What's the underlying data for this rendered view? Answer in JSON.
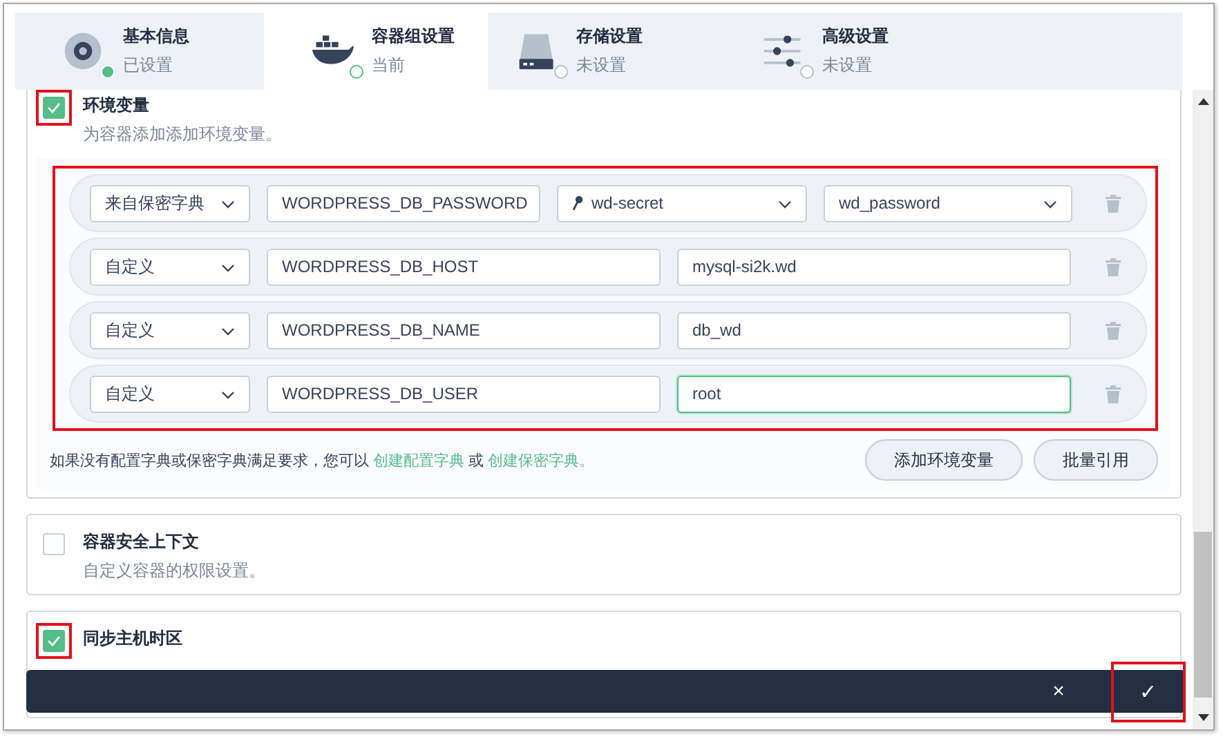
{
  "tabs": [
    {
      "title": "基本信息",
      "status_text": "已设置",
      "completed": true,
      "selected": false
    },
    {
      "title": "容器组设置",
      "status_text": "当前",
      "completed": false,
      "selected": true
    },
    {
      "title": "存储设置",
      "status_text": "未设置",
      "completed": false,
      "selected": false
    },
    {
      "title": "高级设置",
      "status_text": "未设置",
      "completed": false,
      "selected": false
    }
  ],
  "sections": [
    {
      "kind": "env",
      "title": "环境变量",
      "description": "为容器添加添加环境变量。",
      "checked": true,
      "highlighted": true,
      "rows_highlighted": true,
      "rows": [
        {
          "kind": "secret",
          "type": "来自保密字典",
          "name": "WORDPRESS_DB_PASSWORD",
          "secret": "wd-secret",
          "key": "wd_password",
          "focused": false
        },
        {
          "kind": "custom",
          "type": "自定义",
          "name": "WORDPRESS_DB_HOST",
          "value": "mysql-si2k.wd",
          "focused": false
        },
        {
          "kind": "custom",
          "type": "自定义",
          "name": "WORDPRESS_DB_NAME",
          "value": "db_wd",
          "focused": false
        },
        {
          "kind": "custom",
          "type": "自定义",
          "name": "WORDPRESS_DB_USER",
          "value": "root",
          "focused": true
        }
      ],
      "hint": {
        "text": "如果没有配置字典或保密字典满足要求，您可以",
        "links": [
          "创建配置字典",
          "创建保密字典。"
        ],
        "separator": "或"
      },
      "buttons": [
        "添加环境变量",
        "批量引用"
      ]
    },
    {
      "kind": "plain",
      "title": "容器安全上下文",
      "description": "自定义容器的权限设置。",
      "checked": false,
      "highlighted": false
    },
    {
      "kind": "plain",
      "title": "同步主机时区",
      "checked": true,
      "highlighted": true
    }
  ],
  "action_bar": {
    "cancel": "×",
    "confirm": "✓",
    "confirm_highlighted": true
  }
}
